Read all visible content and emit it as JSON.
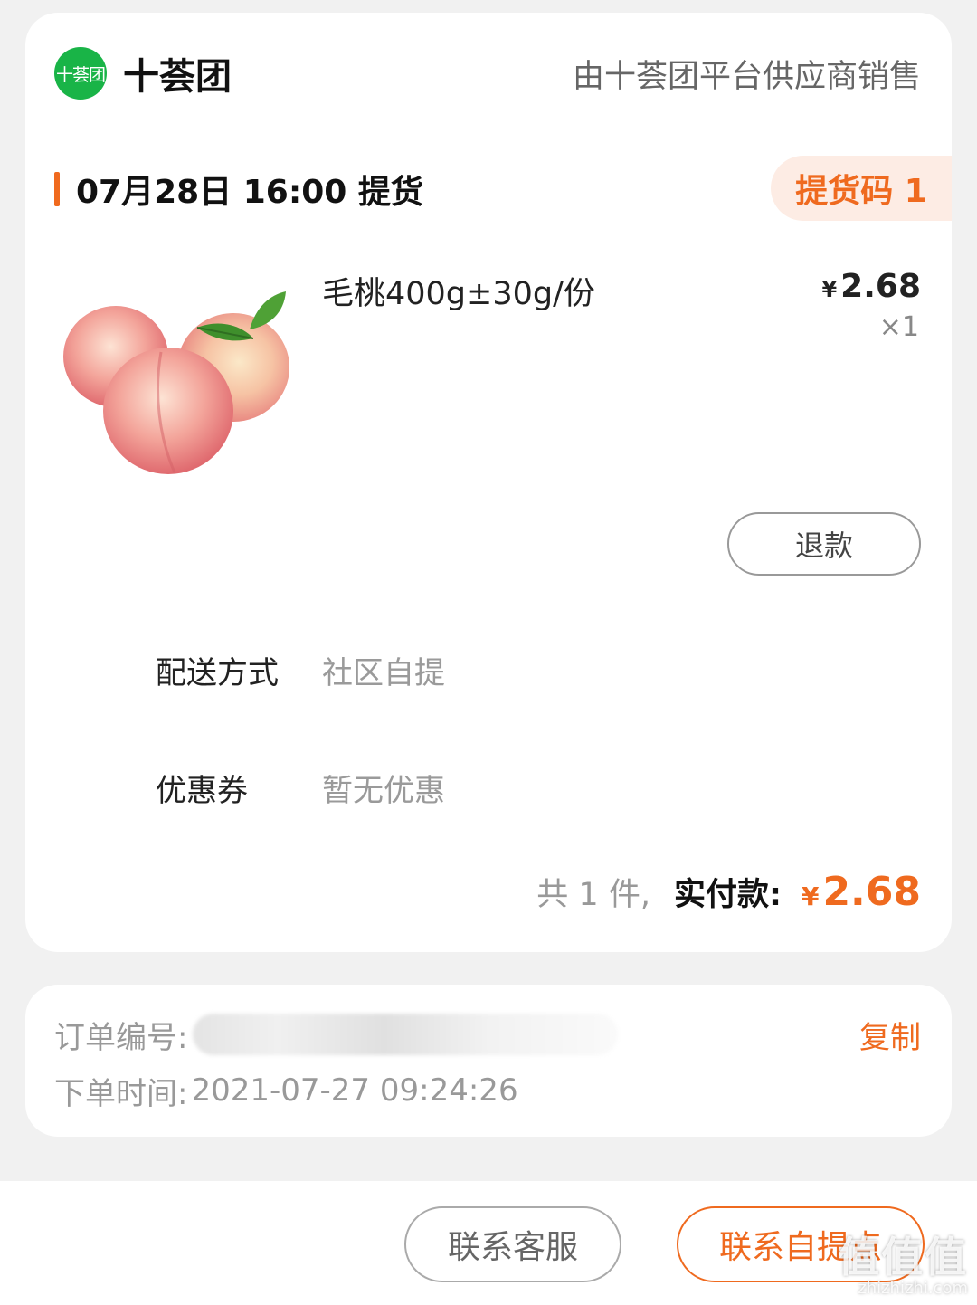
{
  "shop": {
    "logo_text": "十荟团",
    "name": "十荟团",
    "seller_note": "由十荟团平台供应商销售"
  },
  "pickup": {
    "time": "07月28日 16:00 提货",
    "code": "提货码 1"
  },
  "product": {
    "name": "毛桃400g±30g/份",
    "currency": "¥",
    "price": "2.68",
    "quantity": "×1",
    "image": "peach-image"
  },
  "refund_label": "退款",
  "delivery": {
    "label": "配送方式",
    "value": "社区自提"
  },
  "coupon": {
    "label": "优惠券",
    "value": "暂无优惠"
  },
  "total": {
    "count": "共 1 件,",
    "label": "实付款:",
    "currency": "¥",
    "amount": "2.68"
  },
  "order": {
    "number_label": "订单编号:",
    "copy_label": "复制",
    "time_label": "下单时间:",
    "time_value": "2021-07-27 09:24:26"
  },
  "actions": {
    "contact_service": "联系客服",
    "contact_pickup": "联系自提点"
  },
  "watermark": {
    "main": "值值值",
    "site": "zhizhizhi.com"
  },
  "colors": {
    "accent": "#ef6a1f",
    "brand_green": "#19b447",
    "background": "#f1f1f1"
  }
}
